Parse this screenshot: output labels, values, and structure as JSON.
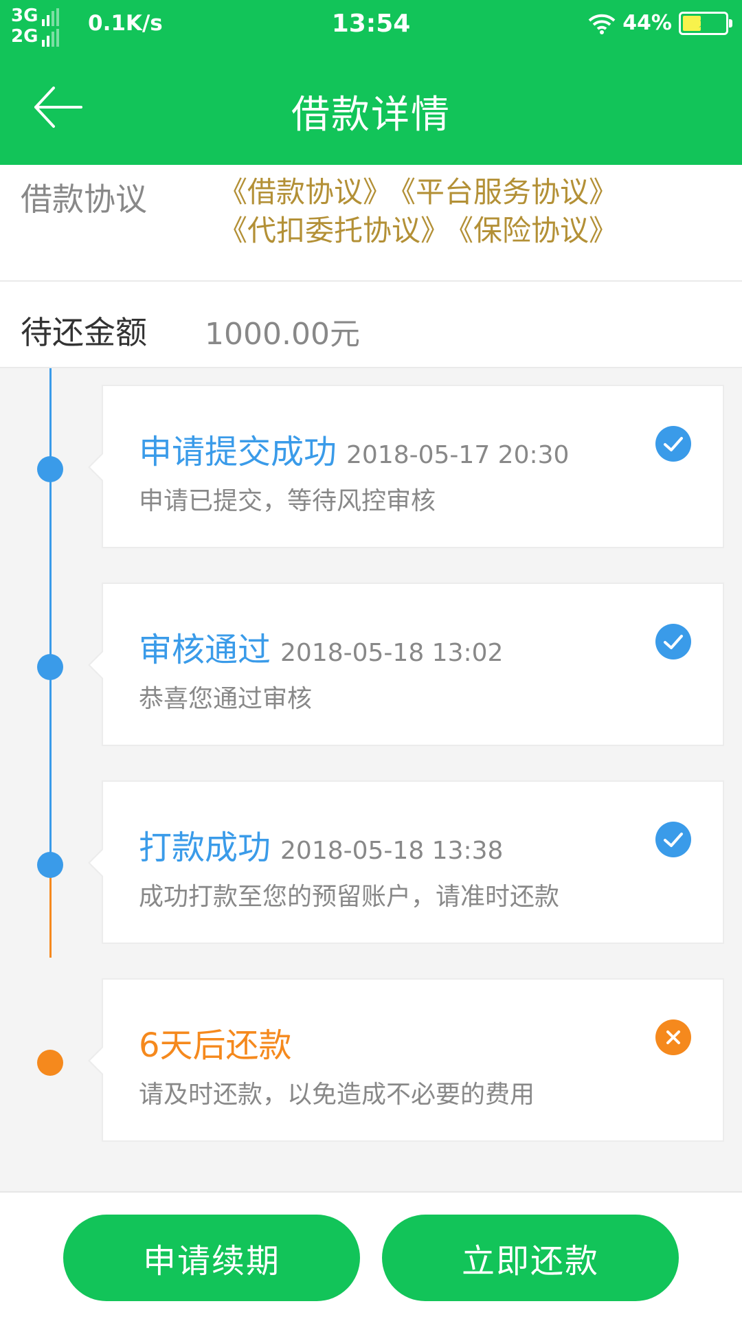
{
  "status_bar": {
    "net_top": "3G",
    "net_bottom": "2G",
    "speed": "0.1K/s",
    "time": "13:54",
    "battery": "44%",
    "battery_level": 0.44
  },
  "header": {
    "title": "借款详情",
    "back_icon": "arrow-left-icon"
  },
  "agreements": {
    "label": "借款协议",
    "links": [
      "《借款协议》",
      "《平台服务协议》",
      "《代扣委托协议》",
      "《保险协议》"
    ]
  },
  "amount": {
    "label": "待还金额",
    "value": "1000.00元"
  },
  "timeline": [
    {
      "title": "申请提交成功",
      "date": "2018-05-17 20:30",
      "desc": "申请已提交，等待风控审核",
      "status": "done",
      "color": "#3a9be9"
    },
    {
      "title": "审核通过",
      "date": "2018-05-18 13:02",
      "desc": "恭喜您通过审核",
      "status": "done",
      "color": "#3a9be9"
    },
    {
      "title": "打款成功",
      "date": "2018-05-18 13:38",
      "desc": "成功打款至您的预留账户，请准时还款",
      "status": "done",
      "color": "#3a9be9"
    },
    {
      "title": "6天后还款",
      "date": "",
      "desc": "请及时还款，以免造成不必要的费用",
      "status": "pending",
      "color": "#f5891d"
    }
  ],
  "colors": {
    "brand": "#12c459",
    "link": "#b39036",
    "done": "#3a9be9",
    "pending": "#f5891d"
  },
  "actions": {
    "renew": "申请续期",
    "repay": "立即还款"
  }
}
